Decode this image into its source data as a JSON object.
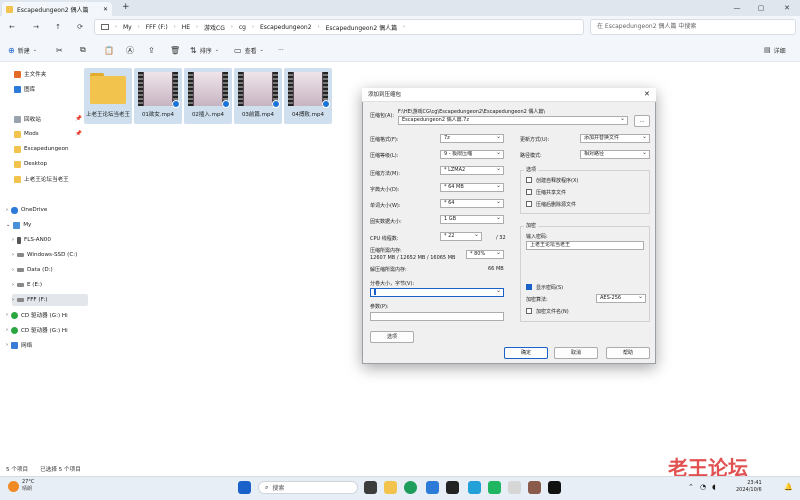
{
  "window": {
    "tab_title": "Escapedungeon2 偶人篇",
    "new_tab": "+"
  },
  "address": {
    "crumbs": [
      "My",
      "FFF (F:)",
      "HE",
      "游戏CG",
      "cg",
      "Escapedungeon2",
      "Escapedungeon2 偶人篇"
    ],
    "search_placeholder": "在 Escapedungeon2 偶人篇 中搜索"
  },
  "toolbar": {
    "new": "新建",
    "sort": "排序",
    "view": "查看",
    "more": "···",
    "details": "详细"
  },
  "sidebar": {
    "items": [
      {
        "label": "主文件夹",
        "icon": "home-icon"
      },
      {
        "label": "图库",
        "icon": "gallery-icon"
      },
      {
        "label": "回收站",
        "icon": "recycle-bin-icon"
      },
      {
        "label": "Mods",
        "icon": "folder-icon"
      },
      {
        "label": "Escapedungeon",
        "icon": "folder-icon"
      },
      {
        "label": "Desktop",
        "icon": "folder-icon"
      },
      {
        "label": "上老王论坛当老王",
        "icon": "folder-icon"
      },
      {
        "label": "OneDrive",
        "icon": "cloud-icon"
      },
      {
        "label": "My",
        "icon": "pc-icon"
      },
      {
        "label": "FLS-AN00",
        "icon": "phone-icon"
      },
      {
        "label": "Windows-SSD (C:)",
        "icon": "drive-icon"
      },
      {
        "label": "Data (D:)",
        "icon": "drive-icon"
      },
      {
        "label": "E (E:)",
        "icon": "drive-icon"
      },
      {
        "label": "FFF (F:)",
        "icon": "drive-icon"
      },
      {
        "label": "CD 驱动器 (G:) Hi",
        "icon": "cd-icon"
      },
      {
        "label": "CD 驱动器 (G:) Hi",
        "icon": "cd-icon"
      },
      {
        "label": "网络",
        "icon": "network-icon"
      }
    ]
  },
  "files": [
    {
      "name": "上老王论坛当老王",
      "type": "folder"
    },
    {
      "name": "01欲女.mp4",
      "type": "video"
    },
    {
      "name": "02插入.mp4",
      "type": "video"
    },
    {
      "name": "03前篇.mp4",
      "type": "video"
    },
    {
      "name": "04搏败.mp4",
      "type": "video"
    }
  ],
  "status": {
    "count": "5 个项目",
    "selected": "已选择 5 个项目"
  },
  "taskbar": {
    "weather_temp": "27°C",
    "weather_desc": "晴朗",
    "search": "搜索",
    "time": "23:41",
    "date": "2024/10/6"
  },
  "dialog": {
    "title": "添加到压缩包",
    "archive_label": "压缩包(A):",
    "archive_path": "F:\\HE\\游戏CG\\cg\\Escapedungeon2\\Escapedungeon2 偶人篇\\",
    "archive_name": "Escapedungeon2 偶人篇.7z",
    "browse": "...",
    "format_label": "压缩格式(F):",
    "format_value": "7z",
    "level_label": "压缩等级(L):",
    "level_value": "9 - 极限压缩",
    "method_label": "压缩方法(M):",
    "method_value": "* LZMA2",
    "dict_label": "字典大小(D):",
    "dict_value": "* 64 MB",
    "word_label": "单词大小(W):",
    "word_value": "* 64",
    "solid_label": "固实数据大小:",
    "solid_value": "1 GB",
    "cpu_label": "CPU 线程数:",
    "cpu_value": "* 22",
    "cpu_max": "/ 32",
    "mem_label": "压缩所需内存:",
    "mem_detail": "12607 MB / 12652 MB / 16065 MB",
    "mem_value": "* 80%",
    "decomp_label": "解压缩所需内存:",
    "decomp_value": "66 MB",
    "split_label": "分卷大小，字节(V):",
    "split_value": "",
    "params_label": "参数(P):",
    "params_value": "",
    "options_button": "选项",
    "update_label": "更新方式(U):",
    "update_value": "添加并替换文件",
    "path_label": "路径模式:",
    "path_value": "相对路径",
    "options_group": "选项",
    "opt_sfx": "创建自释放程序(X)",
    "opt_shared": "压缩共享文件",
    "opt_delete": "压缩后删除源文件",
    "encrypt_group": "加密",
    "password_label": "输入密码:",
    "password_value": "上老王论坛当老王",
    "show_password": "显示密码(S)",
    "enc_method_label": "加密算法:",
    "enc_method_value": "AES-256",
    "encrypt_names": "加密文件名(N)",
    "ok": "确定",
    "cancel": "取消",
    "help": "帮助"
  },
  "watermark": "老王论坛"
}
